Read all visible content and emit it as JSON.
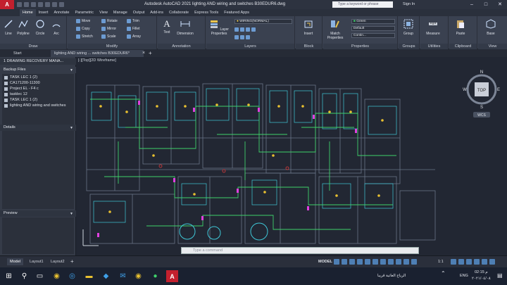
{
  "app": {
    "logo": "A",
    "title": "Autodesk AutoCAD 2021   lighting AND wiring and switches B30EDUR6.dwg",
    "search_placeholder": "Type a keyword or phrase",
    "signin": "Sign In"
  },
  "ribbon_tabs": [
    "Home",
    "Insert",
    "Annotate",
    "Parametric",
    "View",
    "Manage",
    "Output",
    "Add-ins",
    "Collaborate",
    "Express Tools",
    "Featured Apps"
  ],
  "ribbon": {
    "draw": {
      "title": "Draw",
      "line": "Line",
      "polyline": "Polyline",
      "circle": "Circle",
      "arc": "Arc"
    },
    "modify": {
      "title": "Modify",
      "move": "Move",
      "rotate": "Rotate",
      "trim": "Trim",
      "copy": "Copy",
      "mirror": "Mirror",
      "fillet": "Fillet",
      "stretch": "Stretch",
      "scale": "Scale",
      "array": "Array"
    },
    "annotation": {
      "title": "Annotation",
      "text": "Text",
      "dimension": "Dimension"
    },
    "layers": {
      "title": "Layers",
      "layer_properties": "Layer Properties",
      "current_layer": "WIRING(NORMAL)"
    },
    "block": {
      "title": "Block",
      "insert": "Insert"
    },
    "properties": {
      "title": "Properties",
      "match": "Match Properties",
      "color": "Green",
      "linetype": "Default",
      "lineweight": "Contin..."
    },
    "groups": {
      "title": "Groups",
      "group": "Group"
    },
    "utilities": {
      "title": "Utilities",
      "measure": "Measure"
    },
    "clipboard": {
      "title": "Clipboard",
      "paste": "Paste"
    },
    "view": {
      "title": "View",
      "base": "Base"
    }
  },
  "file_tabs": {
    "start": "Start",
    "current": "lighting AND wiring ... switches B30EDUR6*"
  },
  "palette": {
    "header": "1 DRAWING RECOVERY MANA...",
    "backup_title": "Backup Files",
    "files": [
      "TASK LEC 1 (2)",
      "CA171200-11300",
      "Project EL - F4 c",
      "tasklec 12",
      "TASK LEC 1 (2)",
      "lighting AND wiring and switches"
    ],
    "details_title": "Details",
    "preview_title": "Preview",
    "side_label": "DRAWING RECOVERY MANAGER"
  },
  "viewport": {
    "label": "[-][Top][2D Wireframe]",
    "compass": {
      "n": "N",
      "s": "S",
      "e": "E",
      "w": "W",
      "top": "TOP"
    },
    "wcs": "WCS"
  },
  "command_line": {
    "placeholder": "Type a command"
  },
  "layout_tabs": [
    "Model",
    "Layout1",
    "Layout2"
  ],
  "status": {
    "model": "MODEL",
    "scale": "1:1"
  },
  "taskbar": {
    "lang": "ENG",
    "time": "02:15 م",
    "date": "٢٠٢١/٠٤/٠٨",
    "weather": "الرياح العاتية قريبا"
  },
  "colors": {
    "accent": "#3a4150",
    "brand": "#c3202e",
    "drawing_bg": "#222733",
    "wire_green": "#3fd06a",
    "wire_cyan": "#3fc8d8",
    "wire_magenta": "#e040e0",
    "wire_yellow": "#e8c030"
  }
}
